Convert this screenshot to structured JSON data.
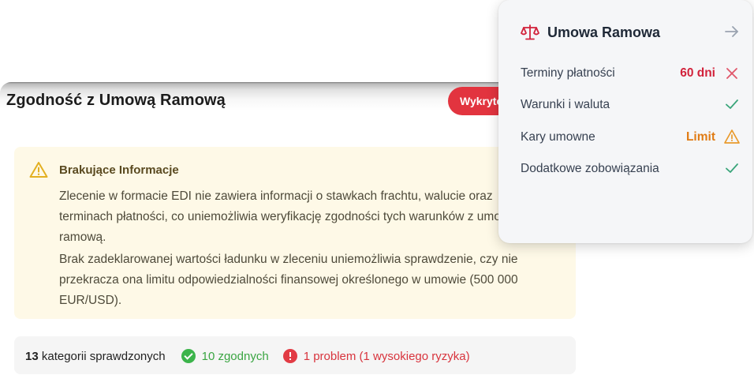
{
  "main": {
    "title": "Zgodność z Umową Ramową",
    "action_button": "Wykryto",
    "warning": {
      "title": "Brakujące Informacje",
      "paragraph1": "Zlecenie w formacie EDI nie zawiera informacji o stawkach frachtu, walucie oraz terminach płatności, co uniemożliwia weryfikację zgodności tych warunków z umową ramową.",
      "paragraph2": "Brak zadeklarowanej wartości ładunku w zleceniu uniemożliwia sprawdzenie, czy nie przekracza ona limitu odpowiedzialności finansowej określonego w umowie (500 000 EUR/USD)."
    },
    "summary": {
      "count": "13",
      "count_label": "kategorii sprawdzonych",
      "ok_text": "10 zgodnych",
      "problem_text": "1 problem (1 wysokiego ryzyka)"
    }
  },
  "panel": {
    "title": "Umowa Ramowa",
    "icon": "scale-icon",
    "rows": [
      {
        "label": "Terminy płatności",
        "value": "60 dni",
        "status": "error",
        "color": "#d2223b"
      },
      {
        "label": "Warunki i waluta",
        "value": "",
        "status": "ok",
        "color": "#3aa57a"
      },
      {
        "label": "Kary umowne",
        "value": "Limit",
        "status": "warning",
        "color": "#e07b14"
      },
      {
        "label": "Dodatkowe zobowiązania",
        "value": "",
        "status": "ok",
        "color": "#3aa57a"
      }
    ]
  },
  "colors": {
    "accent_red": "#e2343f",
    "ok_green": "#3cb44b",
    "warning_bg": "#fef9e7"
  }
}
